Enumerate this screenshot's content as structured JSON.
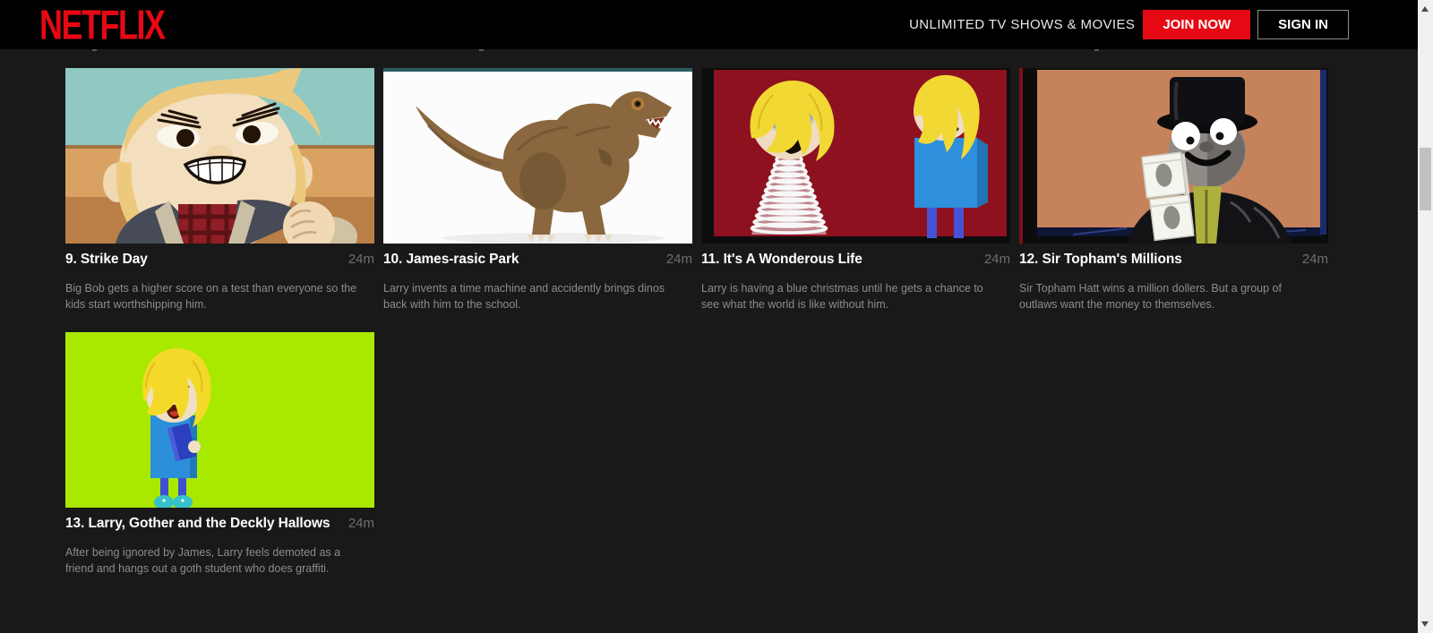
{
  "header": {
    "logo": "NETFLIX",
    "tagline": "UNLIMITED TV SHOWS & MOVIES",
    "join_now_label": "JOIN NOW",
    "sign_in_label": "SIGN IN"
  },
  "colors": {
    "brand_red": "#e50914",
    "header_bg": "#000000",
    "page_bg": "#191919",
    "title_text": "#ffffff",
    "duration_text": "#6e6e6e",
    "description_text": "#8c8c8c"
  },
  "episodes": [
    {
      "title": "9. Strike Day",
      "duration": "24m",
      "description": "Big Bob gets a higher score on a test than everyone so the kids start worthshipping him.",
      "thumbnail_name": "grinning-blond-boy-art"
    },
    {
      "title": "10. James-rasic Park",
      "duration": "24m",
      "description": "Larry invents a time machine and accidently brings dinos back with him to the school.",
      "thumbnail_name": "t-rex-art"
    },
    {
      "title": "11. It's A Wonderous Life",
      "duration": "24m",
      "description": "Larry is having a blue christmas until he gets a chance to see what the world is like without him.",
      "thumbnail_name": "mummy-and-sad-figure-red-art"
    },
    {
      "title": "12. Sir Topham's Millions",
      "duration": "24m",
      "description": "Sir Topham Hatt wins a million dollers. But a group of outlaws want the money to themselves.",
      "thumbnail_name": "topham-hatt-money-art"
    },
    {
      "title": "13. Larry, Gother and the Deckly Hallows",
      "duration": "24m",
      "description": "After being ignored by James, Larry feels demoted as a friend and hangs out a goth student who does graffiti.",
      "thumbnail_name": "larry-holding-book-green-art"
    }
  ]
}
